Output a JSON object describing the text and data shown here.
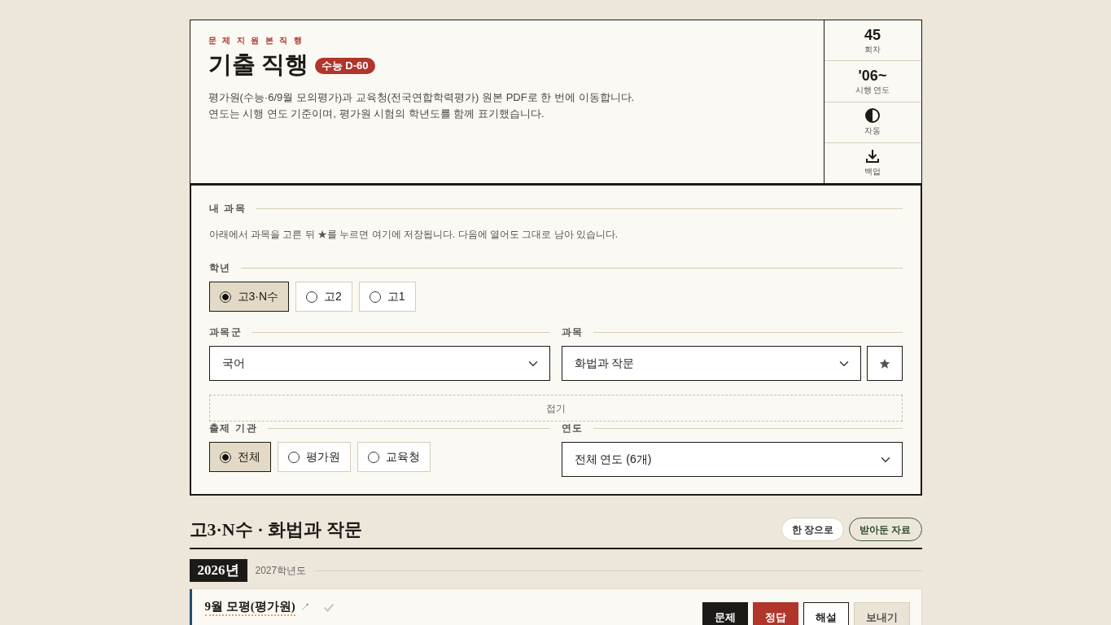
{
  "header": {
    "tagline": "문제지원본직행",
    "title": "기출 직행",
    "badge": "수능 D-60",
    "description": [
      "평가원(수능·6/9월 모의평가)과 교육청(전국연합학력평가) 원본 PDF로 한 번에 이동합니다.",
      "연도는 시행 연도 기준이며, 평가원 시험의 학년도를 함께 표기했습니다."
    ]
  },
  "stats": [
    {
      "kind": "number",
      "value": "45",
      "label": "회차"
    },
    {
      "kind": "number",
      "value": "'06~",
      "label": "시행 연도"
    },
    {
      "kind": "theme",
      "label": "자동"
    },
    {
      "kind": "backup",
      "label": "백업"
    }
  ],
  "panel": {
    "my_subjects": {
      "heading": "내 과목",
      "hint": "아래에서 과목을 고른 뒤 ★를 누르면 여기에 저장됩니다. 다음에 열어도 그대로 남아 있습니다."
    },
    "grade": {
      "heading": "학년",
      "options": [
        {
          "label": "고3·N수",
          "selected": true
        },
        {
          "label": "고2",
          "selected": false
        },
        {
          "label": "고1",
          "selected": false
        }
      ]
    },
    "subject_group": {
      "heading": "과목군",
      "value": "국어"
    },
    "subject": {
      "heading": "과목",
      "value": "화법과 작문"
    },
    "collapse_button": "접기",
    "source": {
      "heading": "출제 기관",
      "options": [
        {
          "label": "전체",
          "selected": true
        },
        {
          "label": "평가원",
          "selected": false
        },
        {
          "label": "교육청",
          "selected": false
        }
      ]
    },
    "year": {
      "heading": "연도",
      "value": "전체 연도 (6개)"
    }
  },
  "results": {
    "title": "고3·N수 · 화법과 작문",
    "actions": [
      {
        "label": "한 장으로",
        "kind": "plain"
      },
      {
        "label": "받아둔 자료",
        "kind": "outline"
      }
    ],
    "groups": [
      {
        "year": "2026년",
        "school_year": "2027학년도",
        "exams": [
          {
            "title": "9월 모평(평가원)",
            "link": "↗",
            "done": false,
            "color": "#1f4e6e",
            "buttons": [
              {
                "label": "문제",
                "kind": "problem"
              },
              {
                "label": "정답",
                "kind": "answer"
              },
              {
                "label": "해설",
                "kind": "solution"
              },
              {
                "label": "보내기",
                "kind": "send"
              }
            ]
          }
        ]
      }
    ]
  }
}
